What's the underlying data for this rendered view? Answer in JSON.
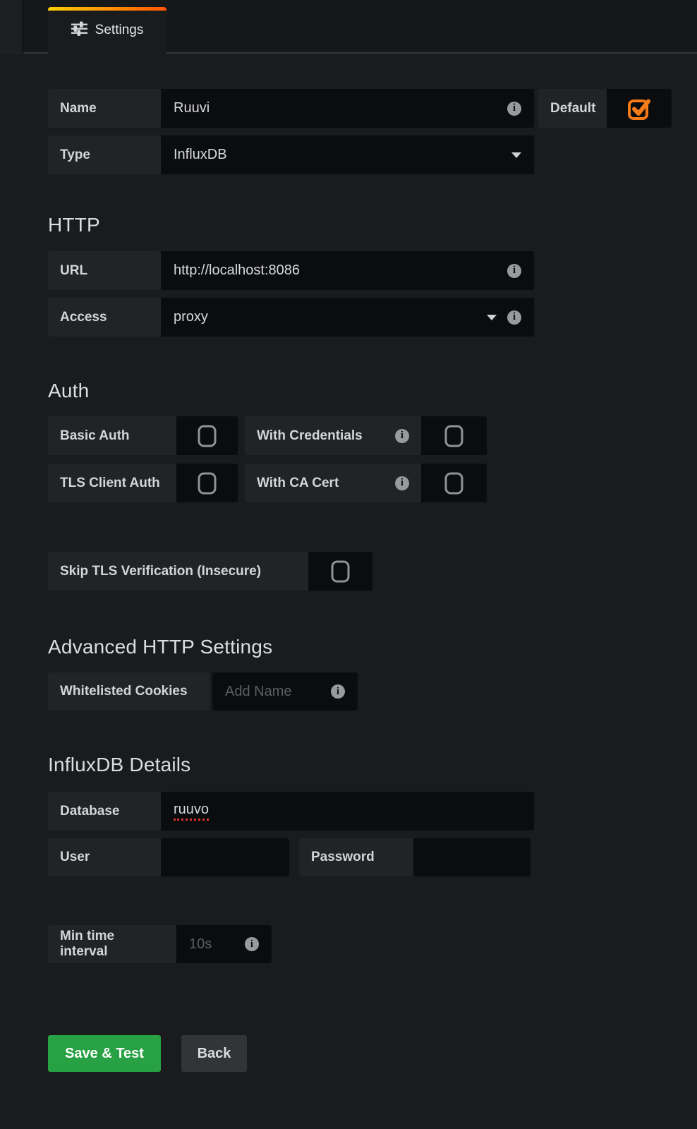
{
  "tab": {
    "label": "Settings"
  },
  "basic": {
    "name_label": "Name",
    "name_value": "Ruuvi",
    "default": {
      "label": "Default",
      "checked": true
    },
    "type_label": "Type",
    "type_value": "InfluxDB"
  },
  "http": {
    "heading": "HTTP",
    "url_label": "URL",
    "url_value": "http://localhost:8086",
    "access_label": "Access",
    "access_value": "proxy"
  },
  "auth": {
    "heading": "Auth",
    "basic_auth": {
      "label": "Basic Auth",
      "checked": false
    },
    "with_credentials": {
      "label": "With Credentials",
      "checked": false
    },
    "tls_client_auth": {
      "label": "TLS Client Auth",
      "checked": false
    },
    "with_ca_cert": {
      "label": "With CA Cert",
      "checked": false
    },
    "skip_tls": {
      "label": "Skip TLS Verification (Insecure)",
      "checked": false
    }
  },
  "advanced": {
    "heading": "Advanced HTTP Settings",
    "cookies_label": "Whitelisted Cookies",
    "cookies_placeholder": "Add Name"
  },
  "influx": {
    "heading": "InfluxDB Details",
    "database_label": "Database",
    "database_value": "ruuvo",
    "user_label": "User",
    "user_value": "",
    "password_label": "Password",
    "password_value": "",
    "min_interval_label": "Min time interval",
    "min_interval_placeholder": "10s"
  },
  "actions": {
    "save_label": "Save & Test",
    "back_label": "Back"
  },
  "colors": {
    "tab_gradient_start": "#ffd000",
    "tab_gradient_end": "#ff5405",
    "accent_orange": "#f57a18",
    "success_green": "#28a044",
    "spellcheck_red": "#e0322b"
  }
}
